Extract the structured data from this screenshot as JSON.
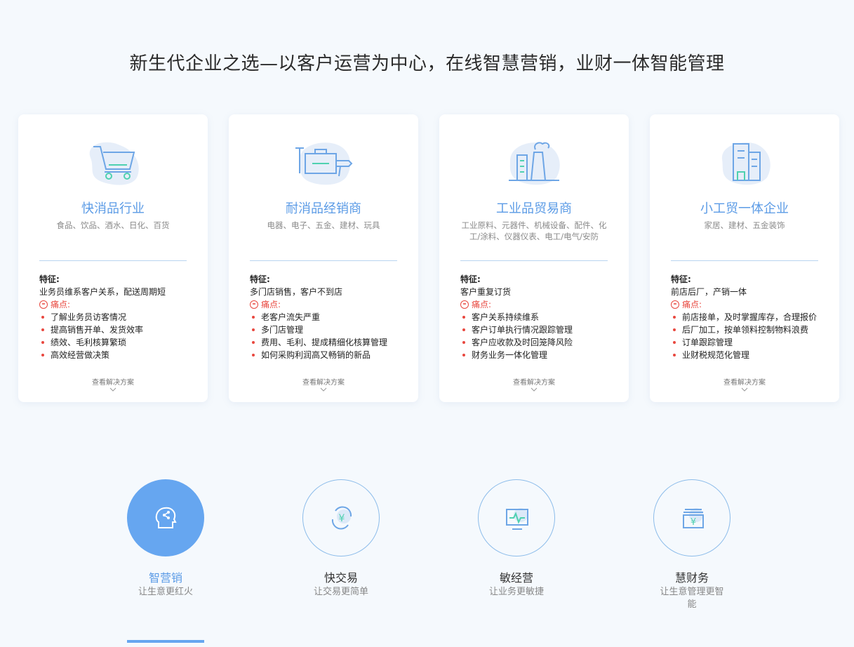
{
  "headline": "新生代企业之选—以客户运营为中心，在线智慧营销，业财一体智能管理",
  "cards": [
    {
      "icon": "shopping-cart-icon",
      "title": "快消品行业",
      "subtitle": "食品、饮品、酒水、日化、百货",
      "feature_label": "特征:",
      "feature_text": "业务员维系客户关系，配送周期短",
      "pain_label": "痛点:",
      "pains": [
        "了解业务员访客情况",
        "提高销售开单、发货效率",
        "绩效、毛利核算繁琐",
        "高效经营做决策"
      ],
      "link": "查看解决方案"
    },
    {
      "icon": "tools-icon",
      "title": "耐消品经销商",
      "subtitle": "电器、电子、五金、建材、玩具",
      "feature_label": "特征:",
      "feature_text": "多门店销售，客户不到店",
      "pain_label": "痛点:",
      "pains": [
        "老客户流失严重",
        "多门店管理",
        "费用、毛利、提成精细化核算管理",
        "如何采购利润高又畅销的新品"
      ],
      "link": "查看解决方案"
    },
    {
      "icon": "factory-icon",
      "title": "工业品贸易商",
      "subtitle": "工业原料、元器件、机械设备、配件、化工/涂料、仪器仪表、电工/电气/安防",
      "feature_label": "特征:",
      "feature_text": "客户重复订货",
      "pain_label": "痛点:",
      "pains": [
        "客户关系持续维系",
        "客户订单执行情况跟踪管理",
        "客户应收款及时回笼降风险",
        "财务业务一体化管理"
      ],
      "link": "查看解决方案"
    },
    {
      "icon": "building-icon",
      "title": "小工贸一体企业",
      "subtitle": "家居、建材、五金装饰",
      "feature_label": "特征:",
      "feature_text": "前店后厂，产销一体",
      "pain_label": "痛点:",
      "pains": [
        "前店接单，及时掌握库存，合理报价",
        "后厂加工，按单领料控制物料浪费",
        "订单跟踪管理",
        "业财税规范化管理"
      ],
      "link": "查看解决方案"
    }
  ],
  "features": [
    {
      "icon": "brain-network-icon",
      "title": "智营销",
      "subtitle": "让生意更红火",
      "active": true
    },
    {
      "icon": "yuan-exchange-icon",
      "title": "快交易",
      "subtitle": "让交易更简单",
      "active": false
    },
    {
      "icon": "monitor-pulse-icon",
      "title": "敏经营",
      "subtitle": "让业务更敏捷",
      "active": false
    },
    {
      "icon": "yuan-stack-icon",
      "title": "慧财务",
      "subtitle": "让生意管理更智能",
      "active": false
    }
  ],
  "colors": {
    "accent": "#5b9be6",
    "pain": "#e8483f",
    "background": "#f5f9fd"
  }
}
